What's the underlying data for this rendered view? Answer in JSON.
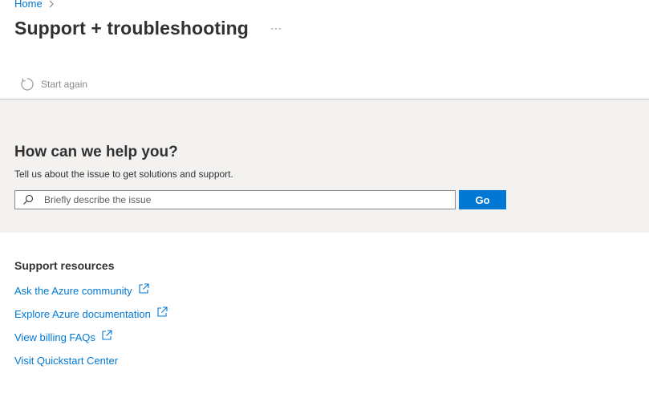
{
  "breadcrumb": {
    "home": "Home"
  },
  "page": {
    "title": "Support + troubleshooting",
    "more": "···"
  },
  "command_bar": {
    "start_again": "Start again"
  },
  "help": {
    "heading": "How can we help you?",
    "subheading": "Tell us about the issue to get solutions and support.",
    "search_placeholder": "Briefly describe the issue",
    "search_value": "",
    "go_label": "Go"
  },
  "resources": {
    "heading": "Support resources",
    "links": [
      {
        "label": "Ask the Azure community",
        "external": true
      },
      {
        "label": "Explore Azure documentation",
        "external": true
      },
      {
        "label": "View billing FAQs",
        "external": true
      },
      {
        "label": "Visit Quickstart Center",
        "external": false
      }
    ]
  },
  "colors": {
    "accent": "#0078d4",
    "panel_bg": "#f3f2f1",
    "text": "#323130"
  },
  "icons": {
    "breadcrumb_separator": "chevron-right-icon",
    "start_again": "refresh-icon",
    "search": "search-icon",
    "external_link": "external-link-icon"
  }
}
